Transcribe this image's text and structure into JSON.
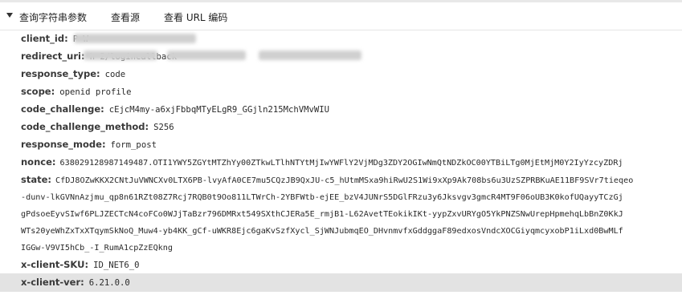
{
  "header": {
    "section_title": "查询字符串参数",
    "view_source_label": "查看源",
    "view_encoded_label": "查看 URL 编码"
  },
  "params": [
    {
      "key": "client_id:",
      "value": "P            W"
    },
    {
      "key": "redirect_uri:",
      "value": "h                                                    2/logincallback"
    },
    {
      "key": "response_type:",
      "value": "code"
    },
    {
      "key": "scope:",
      "value": "openid profile"
    },
    {
      "key": "code_challenge:",
      "value": "cEjcM4my-a6xjFbbqMTyELgR9_GGjln215MchVMvWIU"
    },
    {
      "key": "code_challenge_method:",
      "value": "S256"
    },
    {
      "key": "response_mode:",
      "value": "form_post"
    },
    {
      "key": "nonce:",
      "value": "638029128987149487.OTI1YWY5ZGYtMTZhYy00ZTkwLTlhNTYtMjIwYWFlY2VjMDg3ZDY2OGIwNmQtNDZkOC00YTBiLTg0MjEtMjM0Y2IyYzcyZDRj"
    },
    {
      "key": "state:",
      "value": "CfDJ8OZwKKX2CNtJuVWNCXv0LTX6PB-lvyAfA0CE7mu5CQzJB9QxJU-c5_hUtmMSxa9hiRwU2S1Wi9xXp9Ak708bs6u3UzSZPRBKuAE11BF9SVr7tieqeo"
    }
  ],
  "state_continuation": [
    "-dunv-lkGVNnAzjmu_qp8n61RZt08Z7Rcj7RQB0t9Oo811LTWrCh-2YBFWtb-ejEE_bzV4JUNrS5DGlFRzu3y6Jksvgv3gmcR4MT9F06oUB3K0kofUQayyTCzGj",
    "gPdsoeEyvSIwf6PLJZECTcN4coFCo0WJjTaBzr796DMRxt549SXthCJERa5E_rmjB1-L62AvetTEokikIKt-yypZxvURYgO5YkPNZSNwUrepHpmehqLbBnZ0KkJ",
    "WTs20yeWhZxTxXTqymSkNoQ_Muw4-yb4KK_gCf-uWKR8Ejc6gaKvSzfXycl_SjWNJubmqEO_DHvnmvfxGddggaF89edxosVndcXOCGiyqmcyxobP1iLxd0BwMLf",
    "IGGw-V9VI5hCb_-I_RumA1cpZzEQkng"
  ],
  "extra_params": [
    {
      "key": "x-client-SKU:",
      "value": "ID_NET6_0"
    },
    {
      "key": "x-client-ver:",
      "value": "6.21.0.0"
    }
  ]
}
